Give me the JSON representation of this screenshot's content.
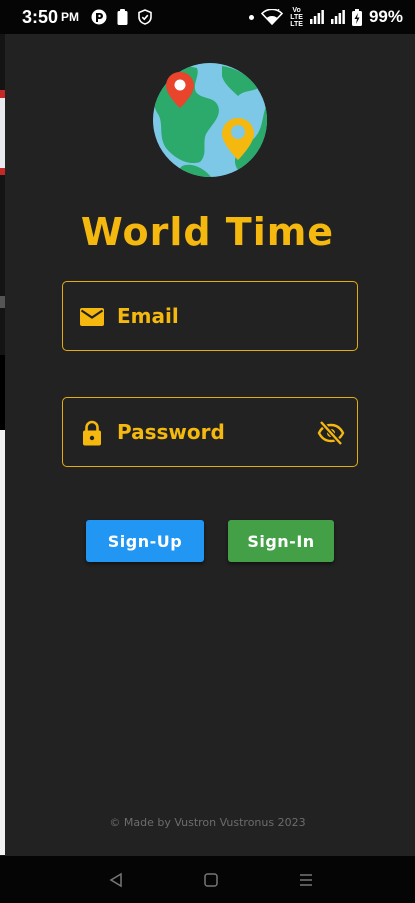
{
  "status_bar": {
    "time": "3:50",
    "ampm": "PM",
    "volte_top": "Vo",
    "volte_mid": "LTE",
    "volte_bot": "LTE",
    "battery": "99%"
  },
  "app": {
    "title": "World Time",
    "email_placeholder": "Email",
    "password_placeholder": "Password",
    "signup_label": "Sign-Up",
    "signin_label": "Sign-In",
    "footer": "© Made by Vustron Vustronus 2023"
  },
  "colors": {
    "accent": "#F5B80F",
    "background": "#222222",
    "signup": "#2196F3",
    "signin": "#43A047",
    "footer_text": "#6c6c6c"
  },
  "icons": {
    "logo": "globe-with-map-pins",
    "email": "mail-icon",
    "password": "lock-icon",
    "visibility": "eye-off-icon",
    "nav_back": "triangle-back-icon",
    "nav_home": "square-home-icon",
    "nav_recents": "three-lines-recents-icon"
  }
}
